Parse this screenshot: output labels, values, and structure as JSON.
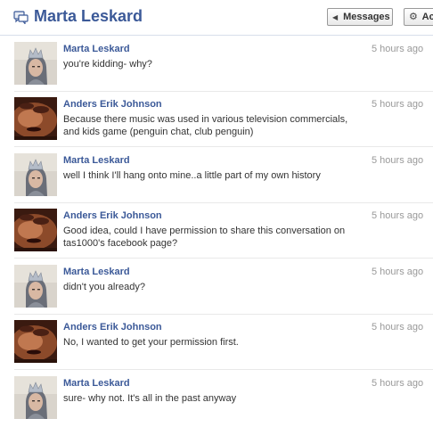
{
  "header": {
    "title": "Marta Leskard",
    "messages_label": "Messages",
    "actions_label": "Ac"
  },
  "messages": [
    {
      "sender": "Marta Leskard",
      "time": "5 hours ago",
      "text": "you're kidding- why?",
      "avatar": "marta-avatar"
    },
    {
      "sender": "Anders Erik Johnson",
      "time": "5 hours ago",
      "text": "Because there music was used in various television commercials, and kids game (penguin chat, club penguin)",
      "avatar": "anders-avatar"
    },
    {
      "sender": "Marta Leskard",
      "time": "5 hours ago",
      "text": "well I think I'll hang onto mine..a little part of my own history",
      "avatar": "marta-avatar"
    },
    {
      "sender": "Anders Erik Johnson",
      "time": "5 hours ago",
      "text": "Good idea, could I have permission to share this conversation on tas1000's facebook page?",
      "avatar": "anders-avatar"
    },
    {
      "sender": "Marta Leskard",
      "time": "5 hours ago",
      "text": "didn't you already?",
      "avatar": "marta-avatar"
    },
    {
      "sender": "Anders Erik Johnson",
      "time": "5 hours ago",
      "text": "No, I wanted to get your permission first.",
      "avatar": "anders-avatar"
    },
    {
      "sender": "Marta Leskard",
      "time": "5 hours ago",
      "text": "sure- why not. It's all in the past anyway",
      "avatar": "marta-avatar"
    }
  ],
  "colors": {
    "link_blue": "#3b5998",
    "timestamp_gray": "#999999"
  }
}
